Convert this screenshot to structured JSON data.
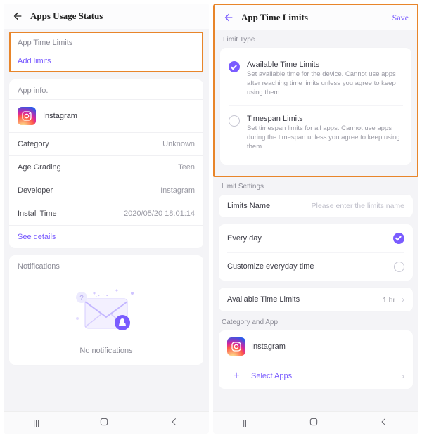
{
  "left": {
    "header": {
      "title": "Apps Usage Status"
    },
    "atl": {
      "title": "App Time Limits",
      "add": "Add limits"
    },
    "appinfo": {
      "label": "App info.",
      "name": "Instagram",
      "rows": [
        {
          "key": "Category",
          "val": "Unknown"
        },
        {
          "key": "Age Grading",
          "val": "Teen"
        },
        {
          "key": "Developer",
          "val": "Instagram"
        },
        {
          "key": "Install Time",
          "val": "2020/05/20 18:01:14"
        }
      ],
      "see": "See details"
    },
    "notif": {
      "label": "Notifications",
      "msg": "No notifications"
    }
  },
  "right": {
    "header": {
      "title": "App Time Limits",
      "save": "Save"
    },
    "limit_type": {
      "label": "Limit Type",
      "options": [
        {
          "title": "Available Time Limits",
          "desc": "Set available time for the device. Cannot use apps after reaching time limits unless you agree to keep using them.",
          "checked": true
        },
        {
          "title": "Timespan Limits",
          "desc": "Set timespan limits for all apps. Cannot use apps during the timespan unless you agree to keep using them.",
          "checked": false
        }
      ]
    },
    "limit_settings": {
      "label": "Limit Settings",
      "name_label": "Limits Name",
      "name_placeholder": "Please enter the limits name"
    },
    "schedule": {
      "every": "Every day",
      "custom": "Customize everyday time"
    },
    "avl": {
      "label": "Available Time Limits",
      "val": "1 hr"
    },
    "catapp": {
      "label": "Category and App",
      "app": "Instagram",
      "select": "Select Apps"
    }
  }
}
